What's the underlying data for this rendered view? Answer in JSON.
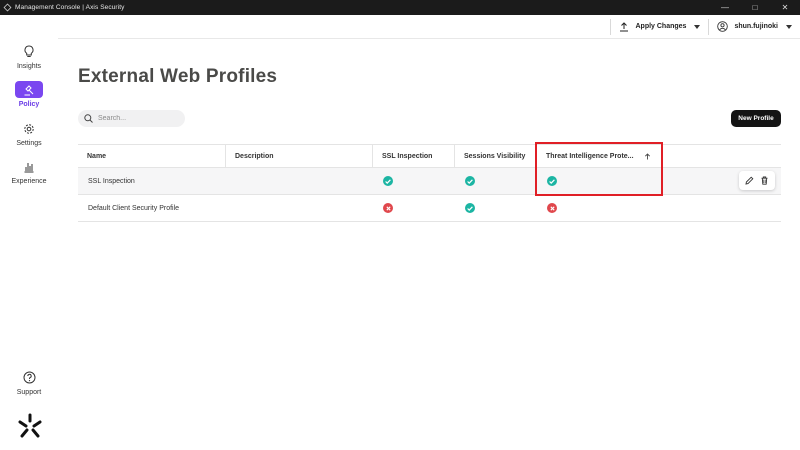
{
  "window": {
    "title": "Management Console | Axis Security"
  },
  "sidebar": {
    "items": [
      {
        "label": "Insights",
        "icon": "lightbulb-icon"
      },
      {
        "label": "Policy",
        "icon": "gavel-icon",
        "active": true
      },
      {
        "label": "Settings",
        "icon": "gear-icon"
      },
      {
        "label": "Experience",
        "icon": "bar-chart-icon"
      }
    ],
    "support": {
      "label": "Support",
      "icon": "help-circle-icon"
    },
    "accent": "#7a47f0"
  },
  "header": {
    "apply_label": "Apply Changes",
    "user_label": "shun.fujinoki"
  },
  "page": {
    "title": "External Web Profiles",
    "search_placeholder": "Search...",
    "new_button": "New Profile"
  },
  "table": {
    "columns": [
      "Name",
      "Description",
      "SSL Inspection",
      "Sessions Visibility",
      "Threat Intelligence Prote..."
    ],
    "rows": [
      {
        "name": "SSL Inspection",
        "description": "",
        "ssl": "check",
        "sessions": "check",
        "threat": "check"
      },
      {
        "name": "Default Client Security Profile",
        "description": "",
        "ssl": "cross",
        "sessions": "check",
        "threat": "cross"
      }
    ],
    "status_colors": {
      "check": "#1cb5a3",
      "cross": "#e0474c"
    }
  }
}
